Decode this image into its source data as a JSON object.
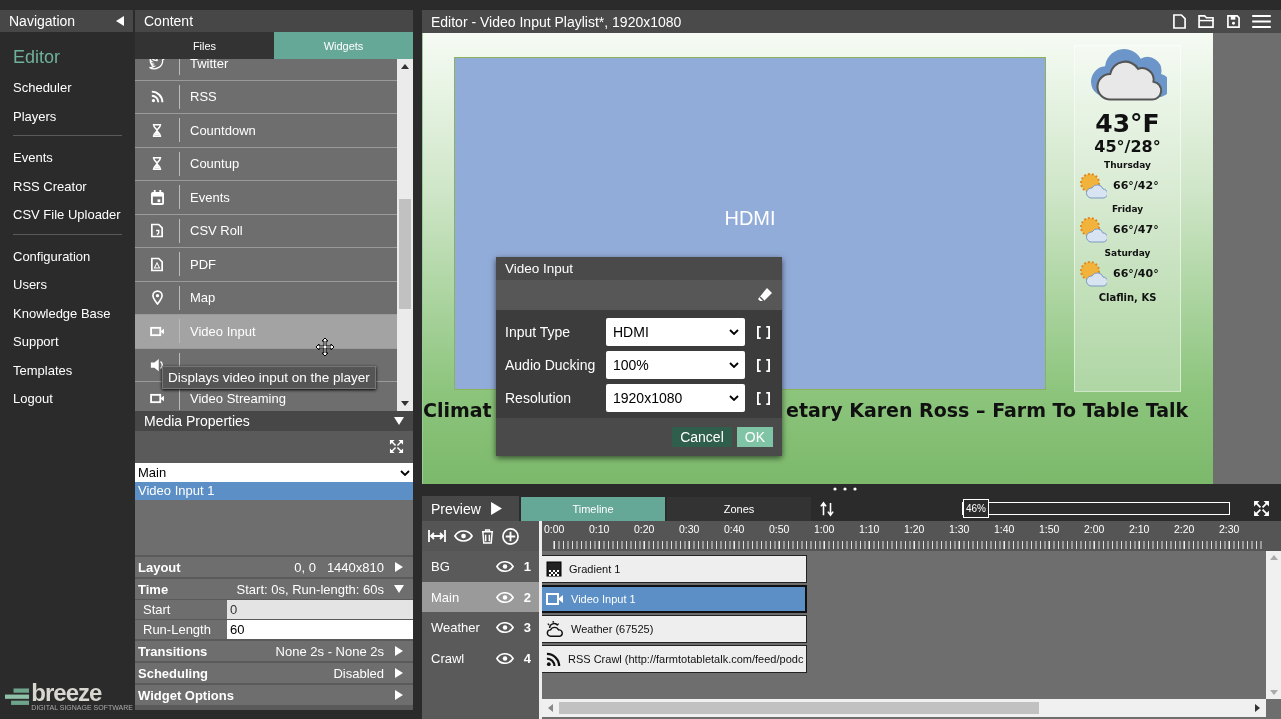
{
  "navigation": {
    "title": "Navigation",
    "groups": [
      {
        "items": [
          {
            "label": "Editor",
            "selected": true
          },
          {
            "label": "Scheduler",
            "selected": false
          },
          {
            "label": "Players",
            "selected": false
          }
        ]
      },
      {
        "items": [
          {
            "label": "Events",
            "selected": false
          },
          {
            "label": "RSS Creator",
            "selected": false
          },
          {
            "label": "CSV File Uploader",
            "selected": false
          }
        ]
      },
      {
        "items": [
          {
            "label": "Configuration",
            "selected": false
          },
          {
            "label": "Users",
            "selected": false
          },
          {
            "label": "Knowledge Base",
            "selected": false
          },
          {
            "label": "Support",
            "selected": false
          },
          {
            "label": "Templates",
            "selected": false
          },
          {
            "label": "Logout",
            "selected": false
          }
        ]
      }
    ]
  },
  "logo": {
    "name": "breeze",
    "tagline": "DIGITAL SIGNAGE SOFTWARE"
  },
  "content": {
    "title": "Content",
    "tabs": [
      {
        "label": "Files",
        "selected": false
      },
      {
        "label": "Widgets",
        "selected": true
      }
    ],
    "widgets": [
      {
        "kind": "twitter",
        "label": "Twitter",
        "highlighted": false
      },
      {
        "kind": "rss",
        "label": "RSS",
        "highlighted": false
      },
      {
        "kind": "hourglass",
        "label": "Countdown",
        "highlighted": false
      },
      {
        "kind": "hourglass",
        "label": "Countup",
        "highlighted": false
      },
      {
        "kind": "calendar",
        "label": "Events",
        "highlighted": false
      },
      {
        "kind": "document",
        "label": "CSV Roll",
        "highlighted": false
      },
      {
        "kind": "pdf",
        "label": "PDF",
        "highlighted": false
      },
      {
        "kind": "pin",
        "label": "Map",
        "highlighted": false
      },
      {
        "kind": "video",
        "label": "Video Input",
        "highlighted": true
      },
      {
        "kind": "speaker",
        "highlighted": false
      },
      {
        "kind": "video",
        "label": "Video Streaming",
        "highlighted": false
      }
    ],
    "tooltip": "Displays video input on the player"
  },
  "media_properties": {
    "title": "Media Properties",
    "zone_select": "Main",
    "items": [
      {
        "label": "Video Input 1",
        "selected": true
      }
    ],
    "sections": [
      {
        "label": "Layout",
        "value": "0, 0   1440x810",
        "expanded": false
      },
      {
        "label": "Time",
        "value": "Start: 0s, Run-length: 60s",
        "expanded": true,
        "fields": [
          {
            "label": "Start",
            "value": "0",
            "disabled": true
          },
          {
            "label": "Run-Length",
            "value": "60",
            "disabled": false
          }
        ]
      },
      {
        "label": "Transitions",
        "value": "None 2s - None 2s",
        "expanded": false
      },
      {
        "label": "Scheduling",
        "value": "Disabled",
        "expanded": false
      },
      {
        "label": "Widget Options",
        "expanded": false
      }
    ]
  },
  "editor": {
    "title": "Editor - Video Input Playlist*, 1920x1080",
    "canvas": {
      "zone_label": "HDMI",
      "weather": {
        "current": "43°F",
        "range": "45°/28°",
        "days": [
          {
            "day": "Thursday",
            "temps": "66°/42°"
          },
          {
            "day": "Friday",
            "temps": "66°/47°"
          },
          {
            "day": "Saturday",
            "temps": "66°/40°"
          }
        ],
        "location": "Claflin, KS"
      },
      "crawl": [
        "Climat",
        "etary Karen Ross – Farm To Table Talk"
      ]
    },
    "dialog": {
      "title": "Video Input",
      "fields": [
        {
          "label": "Input Type",
          "value": "HDMI"
        },
        {
          "label": "Audio Ducking",
          "value": "100%"
        },
        {
          "label": "Resolution",
          "value": "1920x1080"
        }
      ],
      "buttons": [
        {
          "label": "Cancel",
          "kind": "secondary"
        },
        {
          "label": "OK",
          "kind": "primary"
        }
      ]
    }
  },
  "timeline": {
    "preview": "Preview",
    "tabs": [
      {
        "label": "Timeline",
        "selected": true
      },
      {
        "label": "Zones",
        "selected": false
      }
    ],
    "zoom": {
      "reading": "46%",
      "level": 0
    },
    "ruler": [
      "0:00",
      "0:10",
      "0:20",
      "0:30",
      "0:40",
      "0:50",
      "1:00",
      "1:10",
      "1:20",
      "1:30",
      "1:40",
      "1:50",
      "2:00",
      "2:10",
      "2:20",
      "2:30"
    ],
    "layers": [
      {
        "name": "BG",
        "number": "1",
        "selected": false
      },
      {
        "name": "Main",
        "number": "2",
        "selected": true
      },
      {
        "name": "Weather",
        "number": "3",
        "selected": false
      },
      {
        "name": "Crawl",
        "number": "4",
        "selected": false
      }
    ],
    "clips": [
      {
        "kind": "gradient",
        "label": "Gradient 1",
        "selected": false
      },
      {
        "kind": "video",
        "label": "Video Input 1",
        "selected": true
      },
      {
        "kind": "weather",
        "label": "Weather (67525)",
        "selected": false
      },
      {
        "kind": "rss",
        "label": "RSS Crawl (http://farmtotabletalk.com/feed/podc",
        "selected": false
      }
    ]
  }
}
